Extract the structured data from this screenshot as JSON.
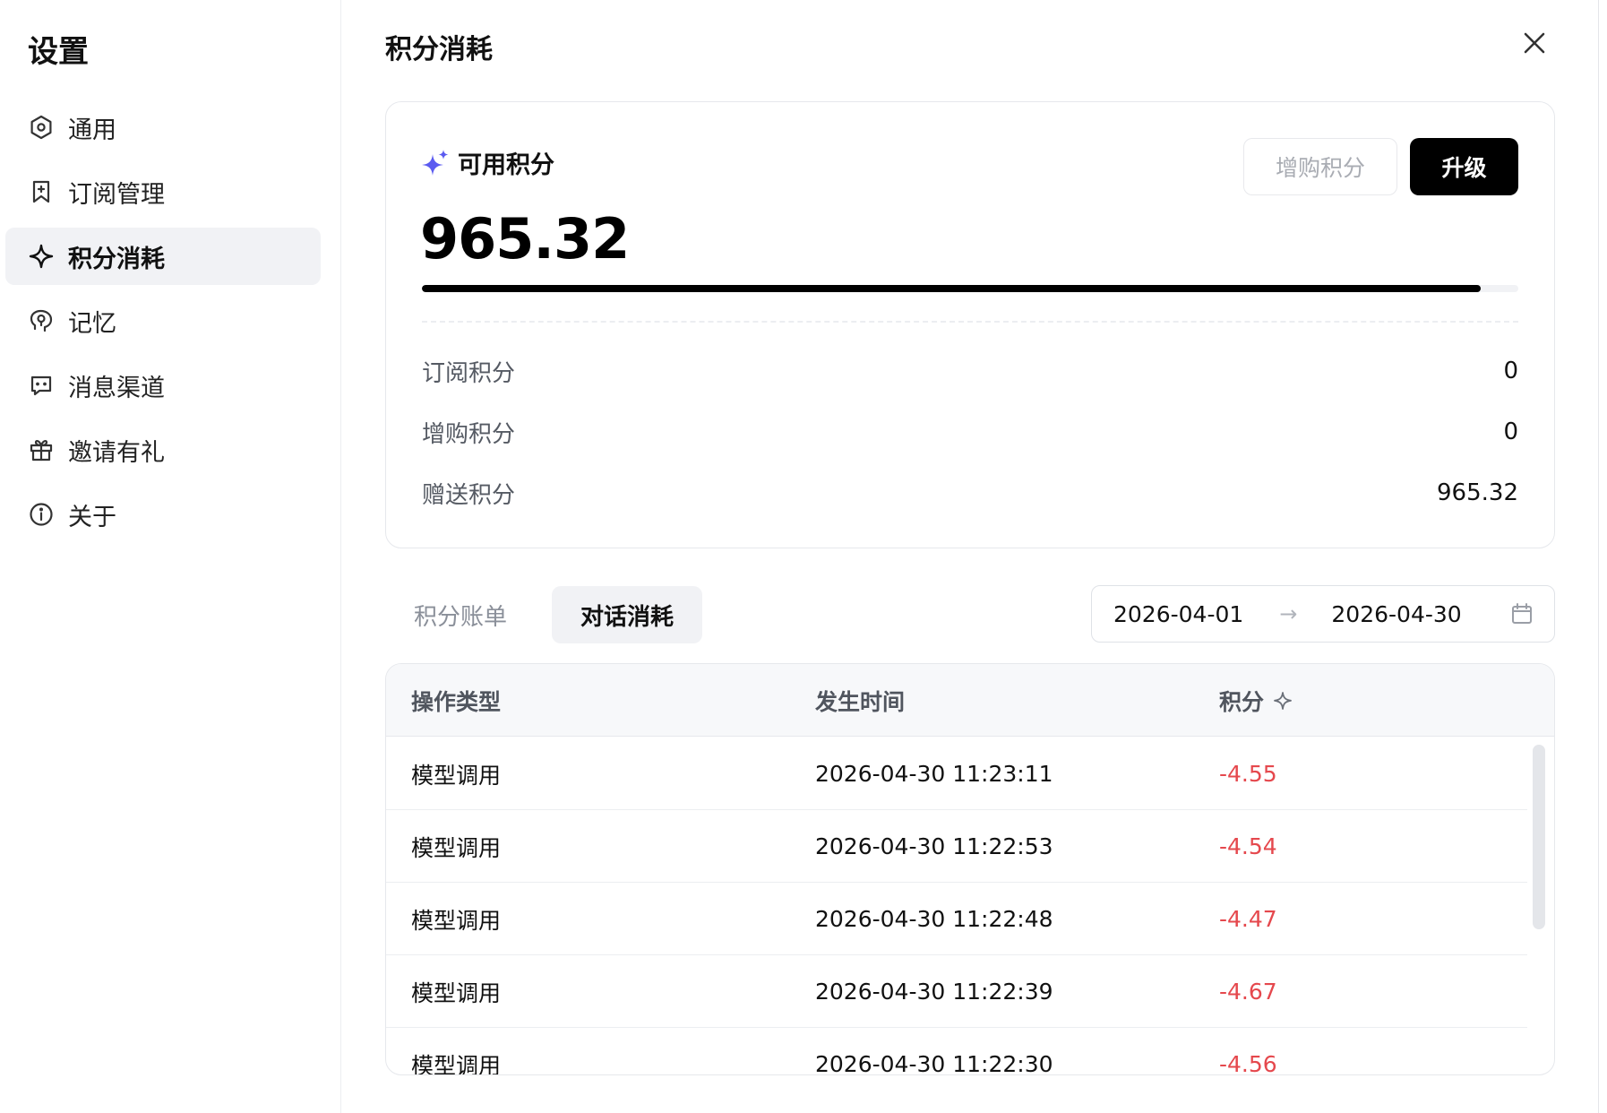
{
  "sidebar": {
    "title": "设置",
    "items": [
      {
        "label": "通用",
        "icon": "settings-icon",
        "active": false
      },
      {
        "label": "订阅管理",
        "icon": "bookmark-plus-icon",
        "active": false
      },
      {
        "label": "积分消耗",
        "icon": "sparkle-icon",
        "active": true
      },
      {
        "label": "记忆",
        "icon": "brain-icon",
        "active": false
      },
      {
        "label": "消息渠道",
        "icon": "chat-icon",
        "active": false
      },
      {
        "label": "邀请有礼",
        "icon": "gift-icon",
        "active": false
      },
      {
        "label": "关于",
        "icon": "info-icon",
        "active": false
      }
    ]
  },
  "main": {
    "title": "积分消耗",
    "close_icon": "close-icon"
  },
  "credits": {
    "label": "可用积分",
    "balance": "965.32",
    "progress_fraction": 0.966,
    "purchase_button": "增购积分",
    "upgrade_button": "升级",
    "breakdown": [
      {
        "name": "订阅积分",
        "value": "0"
      },
      {
        "name": "增购积分",
        "value": "0"
      },
      {
        "name": "赠送积分",
        "value": "965.32"
      }
    ]
  },
  "tabs": [
    {
      "label": "积分账单",
      "active": false
    },
    {
      "label": "对话消耗",
      "active": true
    }
  ],
  "date_range": {
    "start": "2026-04-01",
    "end": "2026-04-30",
    "separator": "→"
  },
  "table": {
    "columns": [
      "操作类型",
      "发生时间",
      "积分"
    ],
    "rows": [
      {
        "type": "模型调用",
        "time": "2026-04-30 11:23:11",
        "points": "-4.55"
      },
      {
        "type": "模型调用",
        "time": "2026-04-30 11:22:53",
        "points": "-4.54"
      },
      {
        "type": "模型调用",
        "time": "2026-04-30 11:22:48",
        "points": "-4.47"
      },
      {
        "type": "模型调用",
        "time": "2026-04-30 11:22:39",
        "points": "-4.67"
      },
      {
        "type": "模型调用",
        "time": "2026-04-30 11:22:30",
        "points": "-4.56"
      }
    ]
  },
  "colors": {
    "accent_sparkle": "#5b5bf0",
    "negative": "#e5484d",
    "primary_button": "#000000"
  }
}
